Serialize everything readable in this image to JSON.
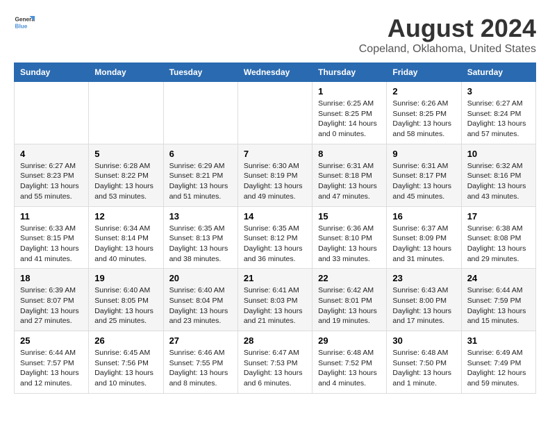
{
  "header": {
    "logo_general": "General",
    "logo_blue": "Blue",
    "title": "August 2024",
    "subtitle": "Copeland, Oklahoma, United States"
  },
  "weekdays": [
    "Sunday",
    "Monday",
    "Tuesday",
    "Wednesday",
    "Thursday",
    "Friday",
    "Saturday"
  ],
  "weeks": [
    [
      {
        "day": "",
        "info": ""
      },
      {
        "day": "",
        "info": ""
      },
      {
        "day": "",
        "info": ""
      },
      {
        "day": "",
        "info": ""
      },
      {
        "day": "1",
        "info": "Sunrise: 6:25 AM\nSunset: 8:25 PM\nDaylight: 14 hours\nand 0 minutes."
      },
      {
        "day": "2",
        "info": "Sunrise: 6:26 AM\nSunset: 8:25 PM\nDaylight: 13 hours\nand 58 minutes."
      },
      {
        "day": "3",
        "info": "Sunrise: 6:27 AM\nSunset: 8:24 PM\nDaylight: 13 hours\nand 57 minutes."
      }
    ],
    [
      {
        "day": "4",
        "info": "Sunrise: 6:27 AM\nSunset: 8:23 PM\nDaylight: 13 hours\nand 55 minutes."
      },
      {
        "day": "5",
        "info": "Sunrise: 6:28 AM\nSunset: 8:22 PM\nDaylight: 13 hours\nand 53 minutes."
      },
      {
        "day": "6",
        "info": "Sunrise: 6:29 AM\nSunset: 8:21 PM\nDaylight: 13 hours\nand 51 minutes."
      },
      {
        "day": "7",
        "info": "Sunrise: 6:30 AM\nSunset: 8:19 PM\nDaylight: 13 hours\nand 49 minutes."
      },
      {
        "day": "8",
        "info": "Sunrise: 6:31 AM\nSunset: 8:18 PM\nDaylight: 13 hours\nand 47 minutes."
      },
      {
        "day": "9",
        "info": "Sunrise: 6:31 AM\nSunset: 8:17 PM\nDaylight: 13 hours\nand 45 minutes."
      },
      {
        "day": "10",
        "info": "Sunrise: 6:32 AM\nSunset: 8:16 PM\nDaylight: 13 hours\nand 43 minutes."
      }
    ],
    [
      {
        "day": "11",
        "info": "Sunrise: 6:33 AM\nSunset: 8:15 PM\nDaylight: 13 hours\nand 41 minutes."
      },
      {
        "day": "12",
        "info": "Sunrise: 6:34 AM\nSunset: 8:14 PM\nDaylight: 13 hours\nand 40 minutes."
      },
      {
        "day": "13",
        "info": "Sunrise: 6:35 AM\nSunset: 8:13 PM\nDaylight: 13 hours\nand 38 minutes."
      },
      {
        "day": "14",
        "info": "Sunrise: 6:35 AM\nSunset: 8:12 PM\nDaylight: 13 hours\nand 36 minutes."
      },
      {
        "day": "15",
        "info": "Sunrise: 6:36 AM\nSunset: 8:10 PM\nDaylight: 13 hours\nand 33 minutes."
      },
      {
        "day": "16",
        "info": "Sunrise: 6:37 AM\nSunset: 8:09 PM\nDaylight: 13 hours\nand 31 minutes."
      },
      {
        "day": "17",
        "info": "Sunrise: 6:38 AM\nSunset: 8:08 PM\nDaylight: 13 hours\nand 29 minutes."
      }
    ],
    [
      {
        "day": "18",
        "info": "Sunrise: 6:39 AM\nSunset: 8:07 PM\nDaylight: 13 hours\nand 27 minutes."
      },
      {
        "day": "19",
        "info": "Sunrise: 6:40 AM\nSunset: 8:05 PM\nDaylight: 13 hours\nand 25 minutes."
      },
      {
        "day": "20",
        "info": "Sunrise: 6:40 AM\nSunset: 8:04 PM\nDaylight: 13 hours\nand 23 minutes."
      },
      {
        "day": "21",
        "info": "Sunrise: 6:41 AM\nSunset: 8:03 PM\nDaylight: 13 hours\nand 21 minutes."
      },
      {
        "day": "22",
        "info": "Sunrise: 6:42 AM\nSunset: 8:01 PM\nDaylight: 13 hours\nand 19 minutes."
      },
      {
        "day": "23",
        "info": "Sunrise: 6:43 AM\nSunset: 8:00 PM\nDaylight: 13 hours\nand 17 minutes."
      },
      {
        "day": "24",
        "info": "Sunrise: 6:44 AM\nSunset: 7:59 PM\nDaylight: 13 hours\nand 15 minutes."
      }
    ],
    [
      {
        "day": "25",
        "info": "Sunrise: 6:44 AM\nSunset: 7:57 PM\nDaylight: 13 hours\nand 12 minutes."
      },
      {
        "day": "26",
        "info": "Sunrise: 6:45 AM\nSunset: 7:56 PM\nDaylight: 13 hours\nand 10 minutes."
      },
      {
        "day": "27",
        "info": "Sunrise: 6:46 AM\nSunset: 7:55 PM\nDaylight: 13 hours\nand 8 minutes."
      },
      {
        "day": "28",
        "info": "Sunrise: 6:47 AM\nSunset: 7:53 PM\nDaylight: 13 hours\nand 6 minutes."
      },
      {
        "day": "29",
        "info": "Sunrise: 6:48 AM\nSunset: 7:52 PM\nDaylight: 13 hours\nand 4 minutes."
      },
      {
        "day": "30",
        "info": "Sunrise: 6:48 AM\nSunset: 7:50 PM\nDaylight: 13 hours\nand 1 minute."
      },
      {
        "day": "31",
        "info": "Sunrise: 6:49 AM\nSunset: 7:49 PM\nDaylight: 12 hours\nand 59 minutes."
      }
    ]
  ]
}
